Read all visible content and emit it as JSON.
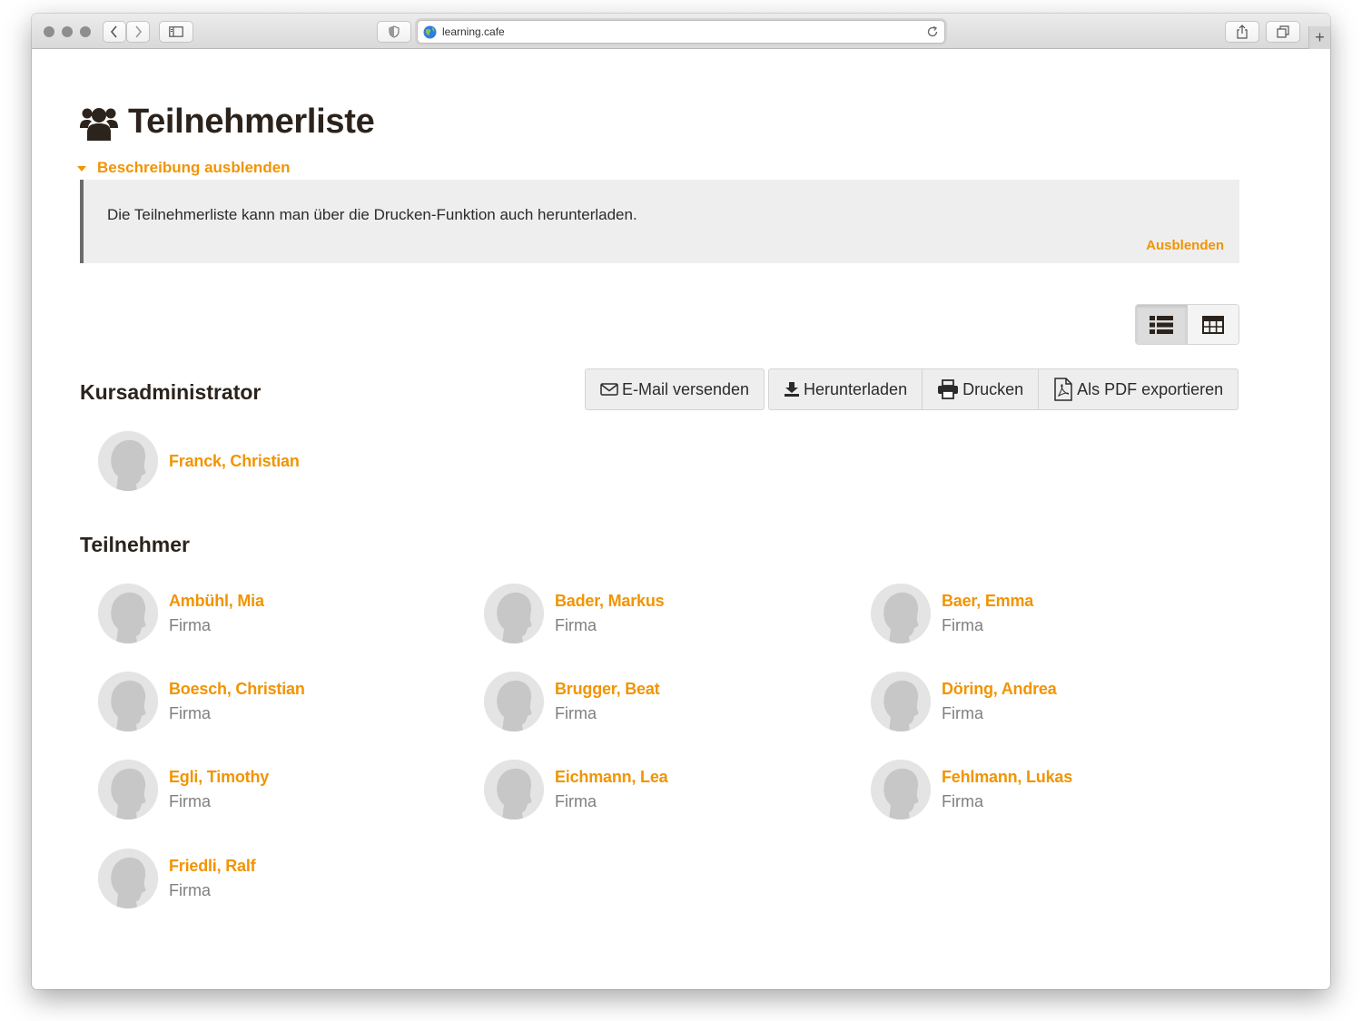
{
  "browser": {
    "url": "learning.cafe"
  },
  "page": {
    "title": "Teilnehmerliste",
    "description_toggle": "Beschreibung ausblenden",
    "description_text": "Die Teilnehmerliste kann man über die Drucken-Funktion auch herunterladen.",
    "description_hide": "Ausblenden"
  },
  "view_switch": {
    "selected": "list",
    "options": [
      "list-icon",
      "table-icon"
    ]
  },
  "actions": {
    "email": "E-Mail versenden",
    "download": "Herunterladen",
    "print": "Drucken",
    "pdf": "Als PDF exportieren"
  },
  "admins": {
    "title": "Kursadministrator",
    "people": [
      {
        "name": "Franck, Christian"
      }
    ]
  },
  "participants": {
    "title": "Teilnehmer",
    "people": [
      {
        "name": "Ambühl, Mia",
        "company": "Firma"
      },
      {
        "name": "Bader, Markus",
        "company": "Firma"
      },
      {
        "name": "Baer, Emma",
        "company": "Firma"
      },
      {
        "name": "Boesch, Christian",
        "company": "Firma"
      },
      {
        "name": "Brugger, Beat",
        "company": "Firma"
      },
      {
        "name": "Döring, Andrea",
        "company": "Firma"
      },
      {
        "name": "Egli, Timothy",
        "company": "Firma"
      },
      {
        "name": "Eichmann, Lea",
        "company": "Firma"
      },
      {
        "name": "Fehlmann, Lukas",
        "company": "Firma"
      },
      {
        "name": "Friedli, Ralf",
        "company": "Firma"
      }
    ]
  },
  "colors": {
    "accent": "#f29400",
    "text": "#2b231c",
    "muted": "#808080"
  }
}
